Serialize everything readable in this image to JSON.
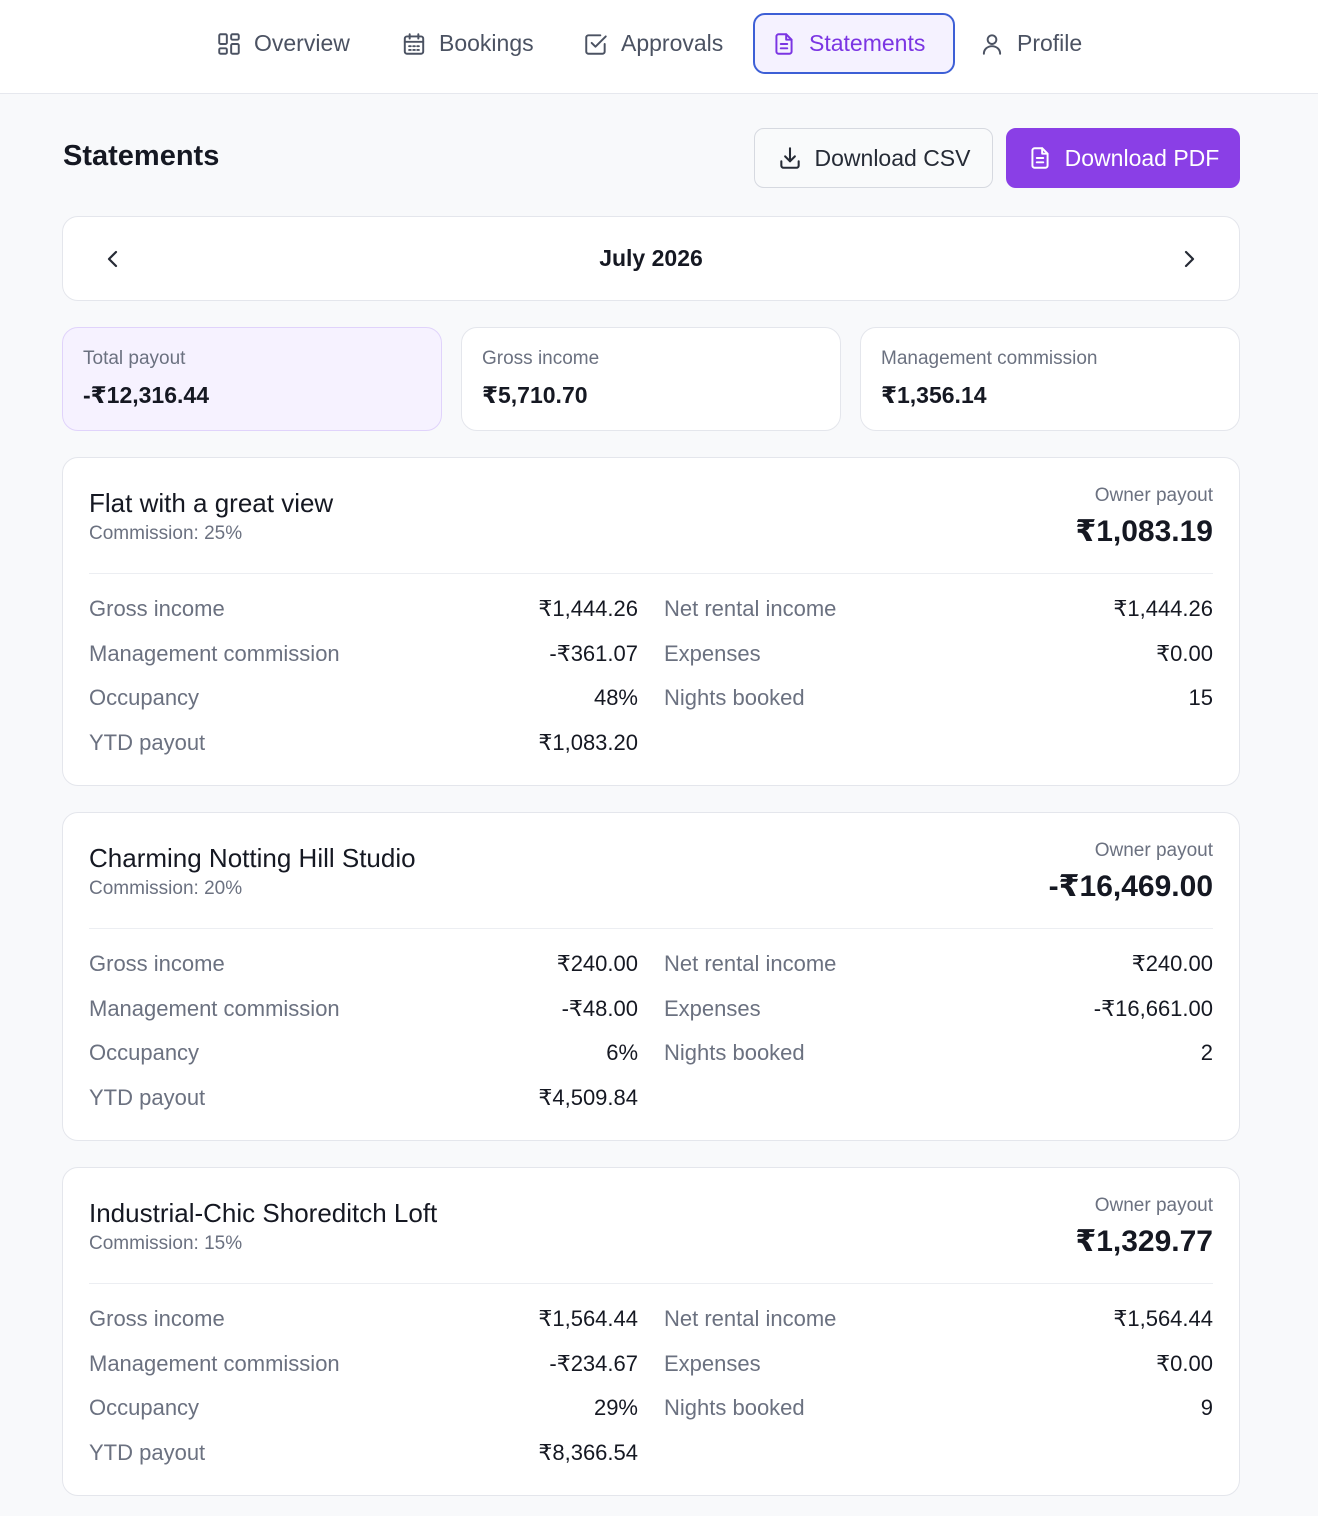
{
  "nav": {
    "items": [
      {
        "label": "Overview",
        "icon": "grid-icon"
      },
      {
        "label": "Bookings",
        "icon": "calendar-icon"
      },
      {
        "label": "Approvals",
        "icon": "check-square-icon"
      },
      {
        "label": "Statements",
        "icon": "document-icon",
        "active": true
      },
      {
        "label": "Profile",
        "icon": "user-icon"
      }
    ]
  },
  "header": {
    "title": "Statements",
    "download_csv_label": "Download CSV",
    "download_pdf_label": "Download PDF"
  },
  "month_selector": {
    "label": "July 2026"
  },
  "summary": {
    "total_payout": {
      "label": "Total payout",
      "value": "-₹12,316.44"
    },
    "gross_income": {
      "label": "Gross income",
      "value": "₹5,710.70"
    },
    "management_commission": {
      "label": "Management commission",
      "value": "₹1,356.14"
    }
  },
  "properties": [
    {
      "name": "Flat with a great view",
      "commission": "Commission: 25%",
      "owner_payout_label": "Owner payout",
      "owner_payout": "₹1,083.19",
      "stats_left": [
        {
          "label": "Gross income",
          "value": "₹1,444.26"
        },
        {
          "label": "Management commission",
          "value": "-₹361.07"
        },
        {
          "label": "Occupancy",
          "value": "48%"
        },
        {
          "label": "YTD payout",
          "value": "₹1,083.20"
        }
      ],
      "stats_right": [
        {
          "label": "Net rental income",
          "value": "₹1,444.26"
        },
        {
          "label": "Expenses",
          "value": "₹0.00"
        },
        {
          "label": "Nights booked",
          "value": "15"
        }
      ]
    },
    {
      "name": "Charming Notting Hill Studio",
      "commission": "Commission: 20%",
      "owner_payout_label": "Owner payout",
      "owner_payout": "-₹16,469.00",
      "stats_left": [
        {
          "label": "Gross income",
          "value": "₹240.00"
        },
        {
          "label": "Management commission",
          "value": "-₹48.00"
        },
        {
          "label": "Occupancy",
          "value": "6%"
        },
        {
          "label": "YTD payout",
          "value": "₹4,509.84"
        }
      ],
      "stats_right": [
        {
          "label": "Net rental income",
          "value": "₹240.00"
        },
        {
          "label": "Expenses",
          "value": "-₹16,661.00"
        },
        {
          "label": "Nights booked",
          "value": "2"
        }
      ]
    },
    {
      "name": "Industrial-Chic Shoreditch Loft",
      "commission": "Commission: 15%",
      "owner_payout_label": "Owner payout",
      "owner_payout": "₹1,329.77",
      "stats_left": [
        {
          "label": "Gross income",
          "value": "₹1,564.44"
        },
        {
          "label": "Management commission",
          "value": "-₹234.67"
        },
        {
          "label": "Occupancy",
          "value": "29%"
        },
        {
          "label": "YTD payout",
          "value": "₹8,366.54"
        }
      ],
      "stats_right": [
        {
          "label": "Net rental income",
          "value": "₹1,564.44"
        },
        {
          "label": "Expenses",
          "value": "₹0.00"
        },
        {
          "label": "Nights booked",
          "value": "9"
        }
      ]
    }
  ],
  "colors": {
    "accent": "#8a3fe6",
    "active_nav_border": "#3d5fd6",
    "active_nav_text": "#7b35e3",
    "highlight_card_bg": "#f6f2ff"
  }
}
